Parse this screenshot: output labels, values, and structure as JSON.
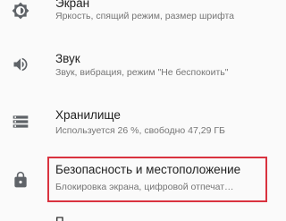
{
  "settings": {
    "items": [
      {
        "title": "Экран",
        "summary": "Яркость, спящий режим, размер шрифта",
        "icon": "display-brightness-icon"
      },
      {
        "title": "Звук",
        "summary": "Звук, вибрация, режим \"Не беспокоить\"",
        "icon": "volume-icon"
      },
      {
        "title": "Хранилище",
        "summary": "Используется 26 %, свободно 47,29 ГБ",
        "icon": "storage-icon"
      },
      {
        "title": "Безопасность и местоположение",
        "summary": "Блокировка экрана, цифровой отпечат…",
        "icon": "lock-icon"
      },
      {
        "title": "П",
        "summary": "",
        "icon": "partial-item-icon"
      }
    ]
  },
  "colors": {
    "highlight": "#d9333f",
    "icon": "#5f6368",
    "title": "#212121",
    "summary": "#757575",
    "background": "#fafafa"
  }
}
